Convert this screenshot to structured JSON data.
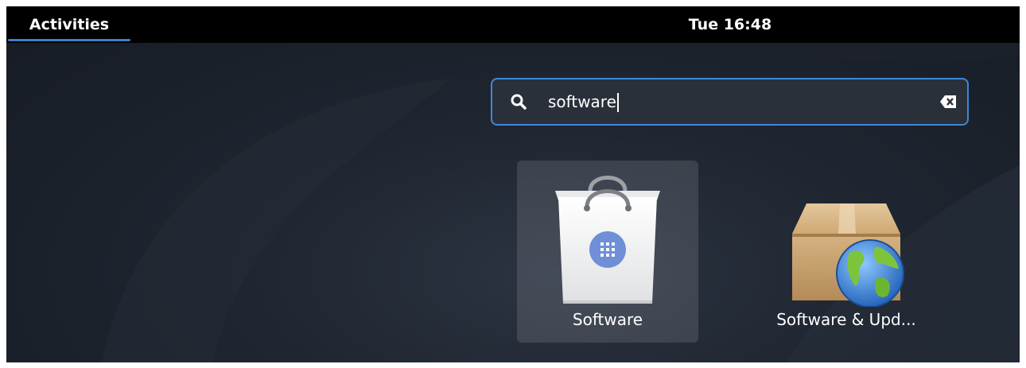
{
  "topbar": {
    "activities_label": "Activities",
    "clock": "Tue 16:48"
  },
  "search": {
    "query": "software",
    "icons": {
      "search": "search-icon",
      "clear": "clear-text-icon"
    }
  },
  "results": [
    {
      "label": "Software",
      "icon": "software-bag-icon",
      "selected": true
    },
    {
      "label": "Software & Upd...",
      "icon": "software-updates-box-globe-icon",
      "selected": false
    }
  ],
  "colors": {
    "accent": "#3b7fd0",
    "topbar_bg": "#000000",
    "overview_bg": "#1f2631"
  }
}
